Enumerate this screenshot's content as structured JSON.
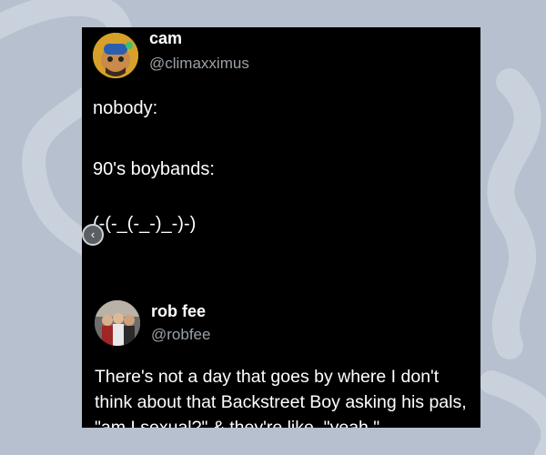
{
  "posts": [
    {
      "display_name": "cam",
      "handle": "@climaxximus",
      "lines": [
        "nobody:",
        "90's boybands:",
        "(-(-_(-_-)_-)-)"
      ]
    },
    {
      "display_name": "rob fee",
      "handle": "@robfee",
      "text": "There's not a day that goes by where I don't think about that Backstreet Boy asking his pals, \"am I sexual?\" & they're like, \"yeah.\""
    }
  ],
  "controls": {
    "prev_icon": "chevron-left-icon",
    "prev_glyph": "‹"
  },
  "colors": {
    "background": "#b6c0ce",
    "card": "#000000",
    "text": "#ffffff",
    "handle": "#9aa1a8"
  }
}
